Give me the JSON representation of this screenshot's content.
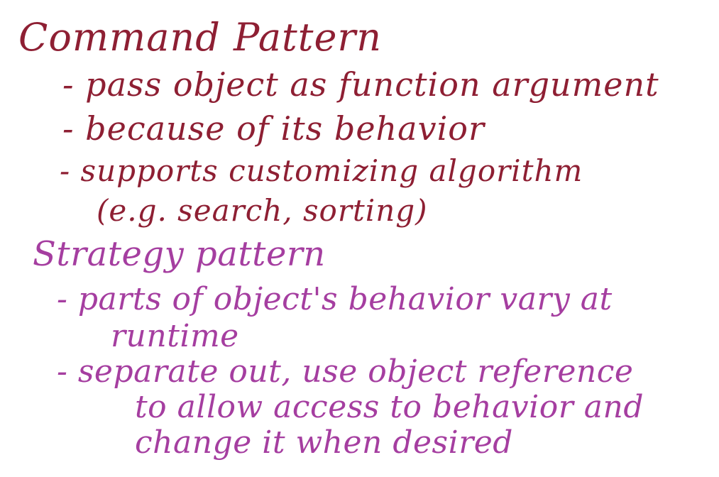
{
  "colors": {
    "section1_ink": "#8e1f33",
    "section2_ink": "#a53ea0",
    "background": "#ffffff"
  },
  "section1": {
    "heading": "Command Pattern",
    "bullet1": "- pass object as function argument",
    "bullet2": "- because of its behavior",
    "bullet3_line1": "- supports customizing algorithm",
    "bullet3_line2": "(e.g. search, sorting)"
  },
  "section2": {
    "heading": "Strategy pattern",
    "bullet1_line1": "- parts of object's behavior vary at",
    "bullet1_line2": "runtime",
    "bullet2_line1": "- separate out, use object reference",
    "bullet2_line2": "to allow access to behavior and",
    "bullet2_line3": "change it when desired"
  }
}
